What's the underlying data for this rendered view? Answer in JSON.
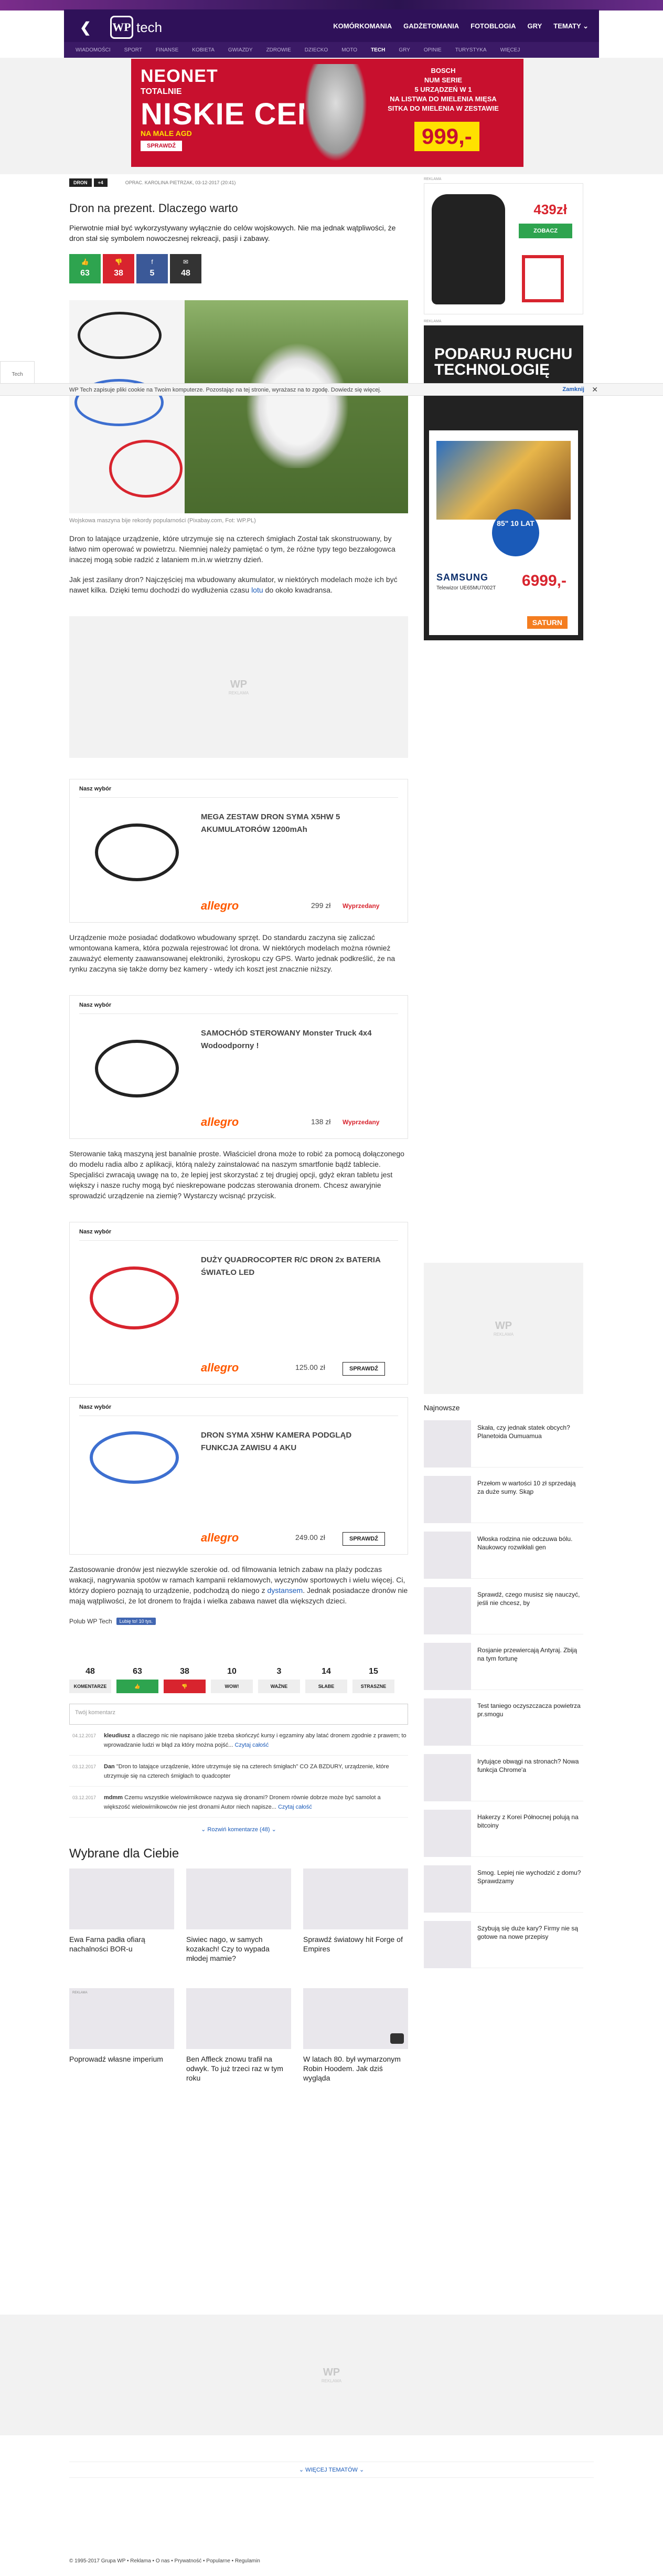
{
  "header": {
    "logo_wp": "WP",
    "logo_section": "tech",
    "back_glyph": "❮",
    "main_nav": [
      "KOMÓRKOMANIA",
      "GADŻETOMANIA",
      "FOTOBLOGIA",
      "GRY",
      "TEMATY ⌄"
    ],
    "sub_nav": [
      "WIADOMOŚCI",
      "SPORT",
      "FINANSE",
      "KOBIETA",
      "GWIAZDY",
      "ZDROWIE",
      "DZIECKO",
      "MOTO",
      "TECH",
      "GRY",
      "OPINIE",
      "TURYSTYKA",
      "WIĘCEJ"
    ],
    "sub_nav_active": "TECH"
  },
  "top_ad": {
    "brand": "NEONET",
    "totalnie": "TOTALNIE",
    "headline": "NISKIE CENY",
    "na_male_ago": "NA MALE AGD",
    "cta": "SPRAWDŹ",
    "bosch_lines": [
      "BOSCH",
      "NUM SERIE",
      "5 URZĄDZEŃ W 1",
      "NA LISTWA DO MIELENIA MIĘSA",
      "SITKA DO MIELENIA W ZESTAWIE"
    ],
    "price": "999,-"
  },
  "left_edge_label": "Tech",
  "cookie": {
    "text": "WP Tech zapisuje pliki cookie na Twoim komputerze. Pozostając na tej stronie, wyrażasz na to zgodę. Dowiedz się więcej.",
    "close_label": "Zamknij",
    "close_glyph": "✕"
  },
  "article": {
    "tags": [
      "DRON",
      "+4"
    ],
    "byline": "OPRAC. KAROLINA PIETRZAK, 03-12-2017 (20:41)",
    "title": "Dron na prezent. Dlaczego warto",
    "lead": "Pierwotnie miał być wykorzystywany wyłącznie do celów wojskowych. Nie ma jednak wątpliwości, że dron stał się symbolem nowoczesnej rekreacji, pasji i zabawy.",
    "shares": [
      {
        "icon": "👍",
        "count": "63"
      },
      {
        "icon": "👎",
        "count": "38"
      },
      {
        "icon": "f",
        "count": "5"
      },
      {
        "icon": "✉",
        "count": "48"
      }
    ],
    "caption": "Wojskowa maszyna bije rekordy popularności (Pixabay.com, Fot: WP.PL)",
    "p1": "Dron to latające urządzenie, które utrzymuje się na czterech śmigłach Został tak skonstruowany, by łatwo nim operować w powietrzu. Niemniej należy pamiętać o tym, że różne typy tego bezzałogowca inaczej mogą sobie radzić z lataniem m.in.w wietrzny dzień.",
    "p2a": "Jak jest zasilany dron? Najczęściej ma wbudowany akumulator, w niektórych modelach może ich być nawet kilka. Dzięki temu dochodzi do wydłużenia czasu ",
    "p2_link": "lotu",
    "p2b": " do około kwadransa.",
    "p3": "Urządzenie może posiadać dodatkowo wbudowany sprzęt. Do standardu zaczyna się zaliczać wmontowana kamera, która pozwala rejestrować lot drona. W niektórych modelach można również zauważyć elementy zaawansowanej elektroniki, żyroskopu czy GPS. Warto jednak podkreślić, że na rynku zaczyna się także dorny bez kamery - wtedy ich koszt jest znacznie niższy.",
    "p4": "Sterowanie taką maszyną jest banalnie proste. Właściciel drona może to robić za pomocą dołączonego do modelu radia albo z aplikacji, którą należy zainstalować na naszym smartfonie bądź tablecie. Specjaliści zwracają uwagę na to, że lepiej jest skorzystać z tej drugiej opcji, gdyż ekran tabletu jest większy i nasze ruchy mogą być nieskrepowane podczas sterowania dronem. Chcesz awaryjnie sprowadzić urządzenie na ziemię? Wystarczy wcisnąć przycisk.",
    "p5a": "Zastosowanie dronów jest niezwykle szerokie od. od filmowania letnich zabaw na plaży podczas wakacji, nagrywania spotów w ramach kampanii reklamowych, wyczynów sportowych i wielu więcej. Ci, którzy dopiero poznają to urządzenie, podchodzą do niego z ",
    "p5_link": "dystansem",
    "p5b": ". Jednak posiadacze dronów nie mają wątpliwości, że lot dronem to frajda i wielka zabawa nawet dla większych dzieci.",
    "follow": "Polub WP Tech",
    "fb_like": "Lubię to! 10 tys."
  },
  "picks": [
    {
      "header": "Nasz wybór",
      "title": "MEGA ZESTAW DRON SYMA X5HW 5 AKUMULATORÓW 1200mAh",
      "shop": "allegro",
      "price": "299 zł",
      "cta": "Wyprzedany"
    },
    {
      "header": "Nasz wybór",
      "title": "SAMOCHÓD STEROWANY Monster Truck 4x4 Wodoodporny !",
      "shop": "allegro",
      "price": "138 zł",
      "cta": "Wyprzedany"
    },
    {
      "header": "Nasz wybór",
      "title": "DUŻY QUADROCOPTER R/C DRON 2x BATERIA ŚWIATŁO LED",
      "shop": "allegro",
      "price": "125.00 zł",
      "cta": "SPRAWDŹ"
    },
    {
      "header": "Nasz wybór",
      "title": "DRON SYMA X5HW KAMERA PODGLĄD FUNKCJA ZAWISU 4 AKU",
      "shop": "allegro",
      "price": "249.00 zł",
      "cta": "SPRAWDŹ"
    }
  ],
  "reactions": [
    {
      "count": "48",
      "label": "KOMENTARZE"
    },
    {
      "count": "63",
      "label": "👍"
    },
    {
      "count": "38",
      "label": "👎"
    },
    {
      "count": "10",
      "label": "WOW!"
    },
    {
      "count": "3",
      "label": "WAŻNE"
    },
    {
      "count": "14",
      "label": "SŁABE"
    },
    {
      "count": "15",
      "label": "STRASZNE"
    }
  ],
  "comments": {
    "placeholder": "Twój komentarz",
    "items": [
      {
        "ts": "04.12.2017",
        "author": "kleudiusz",
        "text": "a dlaczego nic nie napisano jakie trzeba skończyć kursy i egzaminy aby latać dronem zgodnie z prawem; to wprowadzanie ludzi w błąd za który można pojść...",
        "more": "Czytaj całość"
      },
      {
        "ts": "03.12.2017",
        "author": "Dan",
        "text": "\"Dron to latające urządzenie, które utrzymuje się na czterech śmigłach\" CO ZA BZDURY, urządzenie, które utrzymuje się na czterech śmigłach to quadcopter",
        "more": ""
      },
      {
        "ts": "03.12.2017",
        "author": "mdmm",
        "text": "Czemu wszystkie wielowirnikowce nazywa się dronami? Dronem równie dobrze może być samolot a większość wielowirnikowców nie jest dronami Autor niech napisze...",
        "more": "Czytaj całość"
      }
    ],
    "more_label": "⌄ Rozwiń komentarze (48) ⌄"
  },
  "recommended": {
    "title": "Wybrane dla Ciebie",
    "items": [
      {
        "title": "Ewa Farna padła ofiarą nachalności BOR-u",
        "badge": ""
      },
      {
        "title": "Siwiec nago, w samych kozakach! Czy to wypada młodej mamie?",
        "badge": ""
      },
      {
        "title": "Sprawdź światowy hit Forge of Empires",
        "badge": ""
      },
      {
        "title": "Poprowadź własne imperium",
        "badge": "REKLAMA"
      },
      {
        "title": "Ben Affleck znowu trafił na odwyk. To już trzeci raz w tym roku",
        "badge": ""
      },
      {
        "title": "W latach 80. był wymarzonym Robin Hoodem. Jak dziś wygląda",
        "badge": ""
      }
    ]
  },
  "right_ads": {
    "label": "REKLAMA",
    "jacket_price": "439zł",
    "jacket_cta": "ZOBACZ",
    "podaruj": "PODARUJ RUCHU TECHNOLOGIĘ",
    "badge": "85\" 10 LAT",
    "samsung": "SAMSUNG",
    "model": "Telewizor UE65MU7002T",
    "price": "6999,-",
    "saturn": "SATURN"
  },
  "najnowsze": {
    "title": "Najnowsze",
    "items": [
      "Skała, czy jednak statek obcych? Planetoida Oumuamua",
      "Przełom w wartości 10 zł sprzedają za duże sumy. Skąp",
      "Włoska rodzina nie odczuwa bólu. Naukowcy rozwikłali gen",
      "Sprawdź, czego musisz się nauczyć, jeśli nie chcesz, by",
      "Rosjanie przewiercają Antyraj. Zbiją na tym fortunę",
      "Test taniego oczyszczacza powietrza pr.smogu",
      "Irytujące obwągi na stronach? Nowa funkcja Chrome'a",
      "Hakerzy z Korei Północnej polują na bitcoiny",
      "Smog. Lepiej nie wychodzić z domu? Sprawdzamy",
      "Szybują się duże kary? Firmy nie są gotowe na nowe przepisy"
    ]
  },
  "footer": {
    "more_topics": "⌄ WIĘCEJ TEMATÓW ⌄",
    "copyright": "© 1995-2017 Grupa WP • Reklama • O nas • Prywatność • Popularne • Regulamin"
  },
  "watermark": {
    "text": "WP",
    "sub": "REKLAMA"
  }
}
